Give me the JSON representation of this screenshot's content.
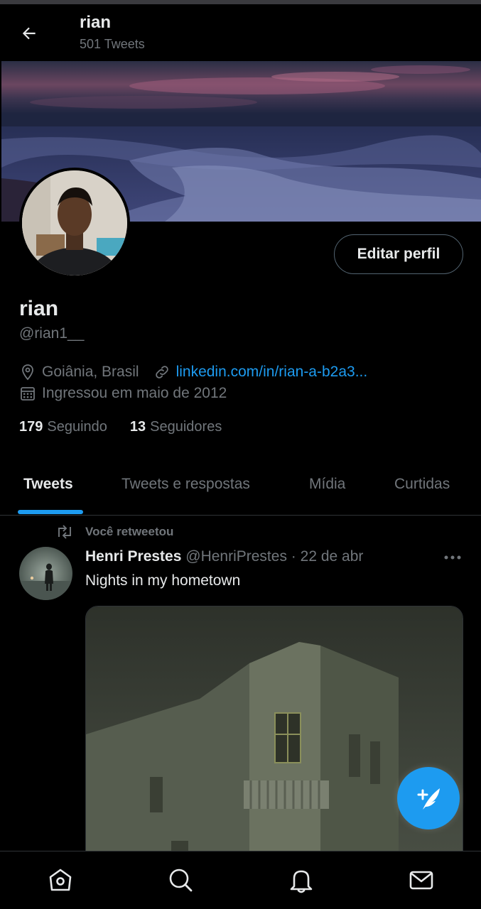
{
  "header": {
    "back_icon": "arrow-left-icon",
    "name": "rian",
    "tweet_count": "501 Tweets"
  },
  "profile": {
    "banner": "ocean-at-dusk-photo",
    "avatar": "profile-photo",
    "edit_button": "Editar perfil",
    "name": "rian",
    "handle": "@rian1__",
    "location": "Goiânia, Brasil",
    "website": "linkedin.com/in/rian-a-b2a3...",
    "joined": "Ingressou em maio de 2012",
    "following_count": "179",
    "following_label": "Seguindo",
    "followers_count": "13",
    "followers_label": "Seguidores"
  },
  "tabs": [
    {
      "label": "Tweets",
      "active": true
    },
    {
      "label": "Tweets e respostas",
      "active": false
    },
    {
      "label": "Mídia",
      "active": false
    },
    {
      "label": "Curtidas",
      "active": false
    }
  ],
  "tweet": {
    "retweet_label": "Você retweetou",
    "author_name": "Henri Prestes",
    "author_handle": "@HenriPrestes",
    "separator": "·",
    "date": "22 de abr",
    "text": "Nights in my hometown",
    "media": "old-building-night-photo"
  },
  "fab": {
    "icon": "compose-tweet-icon"
  },
  "bottom_nav": [
    {
      "icon": "home-icon"
    },
    {
      "icon": "search-icon"
    },
    {
      "icon": "notifications-icon"
    },
    {
      "icon": "messages-icon"
    }
  ],
  "colors": {
    "background": "#000000",
    "accent": "#1d9bf0",
    "text_primary": "#e7e9ea",
    "text_secondary": "#71767b",
    "divider": "#2f3336"
  }
}
